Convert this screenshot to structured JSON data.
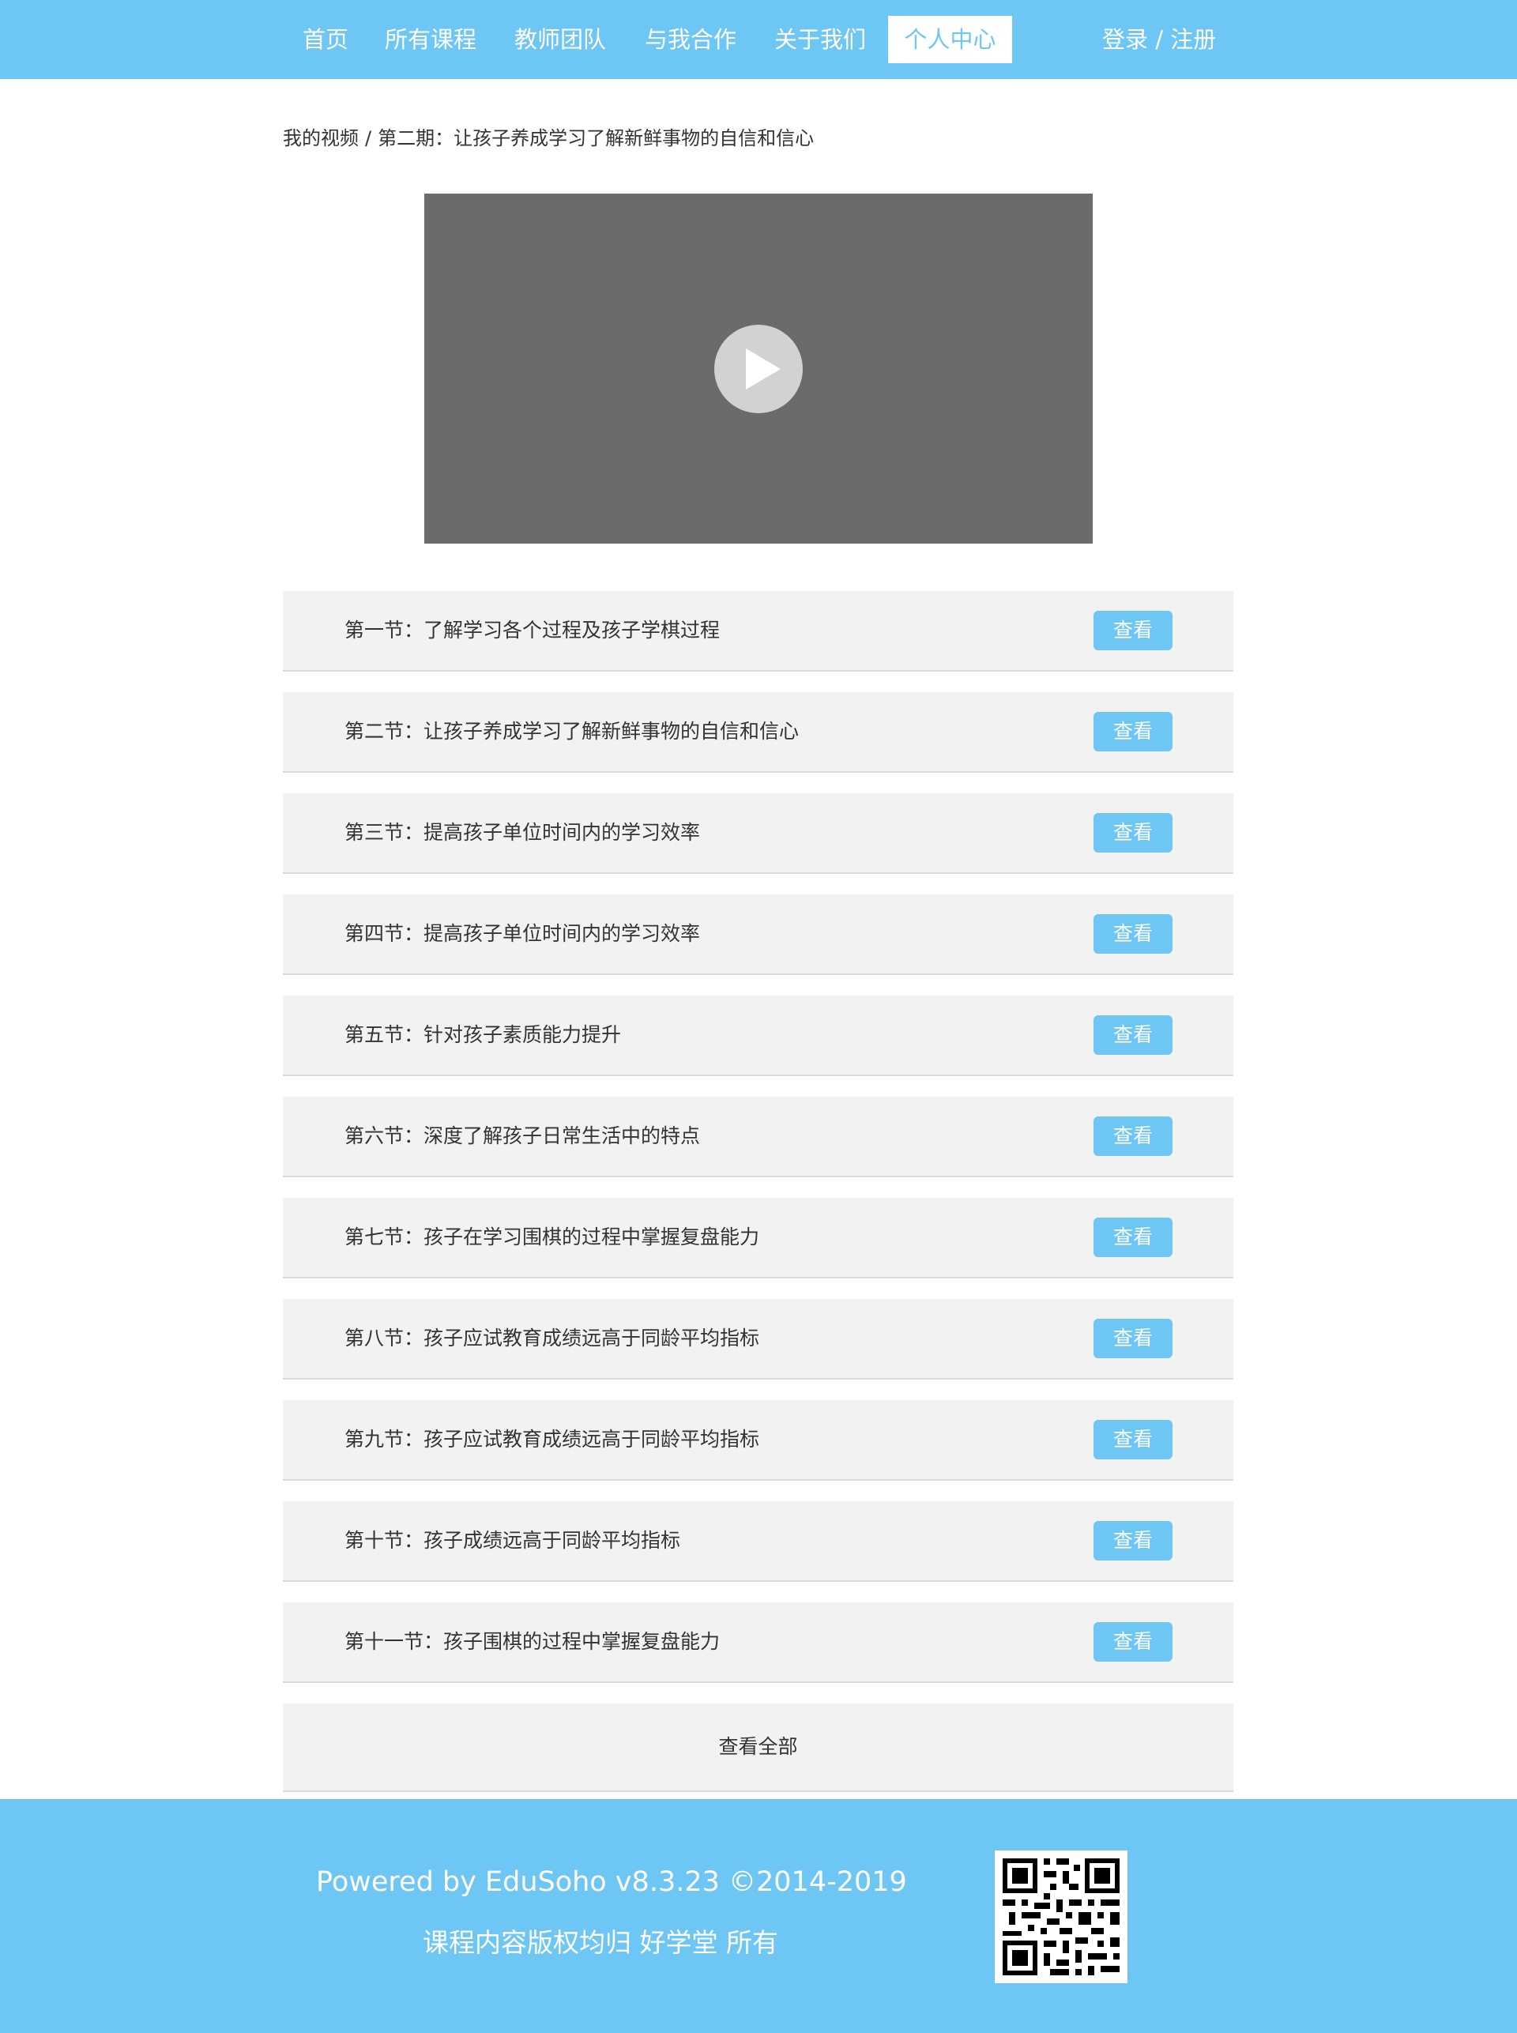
{
  "colors": {
    "accent": "#6ec6f5",
    "video_bg": "#6b6b6b",
    "row_bg": "#f2f2f2"
  },
  "nav": {
    "items": [
      "首页",
      "所有课程",
      "教师团队",
      "与我合作",
      "关于我们",
      "个人中心"
    ],
    "active_index": 5,
    "login": "登录 / 注册"
  },
  "breadcrumb": {
    "parent": "我的视频",
    "separator": "/",
    "current": "第二期：让孩子养成学习了解新鲜事物的自信和信心"
  },
  "video": {
    "play_icon": "play-icon"
  },
  "lessons": [
    {
      "title": "第一节：了解学习各个过程及孩子学棋过程",
      "button": "查看"
    },
    {
      "title": "第二节：让孩子养成学习了解新鲜事物的自信和信心",
      "button": "查看"
    },
    {
      "title": "第三节：提高孩子单位时间内的学习效率",
      "button": "查看"
    },
    {
      "title": "第四节：提高孩子单位时间内的学习效率",
      "button": "查看"
    },
    {
      "title": "第五节：针对孩子素质能力提升",
      "button": "查看"
    },
    {
      "title": "第六节：深度了解孩子日常生活中的特点",
      "button": "查看"
    },
    {
      "title": "第七节：孩子在学习围棋的过程中掌握复盘能力",
      "button": "查看"
    },
    {
      "title": "第八节：孩子应试教育成绩远高于同龄平均指标",
      "button": "查看"
    },
    {
      "title": "第九节：孩子应试教育成绩远高于同龄平均指标",
      "button": "查看"
    },
    {
      "title": "第十节：孩子成绩远高于同龄平均指标",
      "button": "查看"
    },
    {
      "title": "第十一节：孩子围棋的过程中掌握复盘能力",
      "button": "查看"
    }
  ],
  "view_all": "查看全部",
  "footer": {
    "powered_by": "Powered by EduSoho v8.3.23 ©2014-2019",
    "copyright": "课程内容版权均归 好学堂 所有",
    "qr_icon": "qr-code-icon"
  }
}
